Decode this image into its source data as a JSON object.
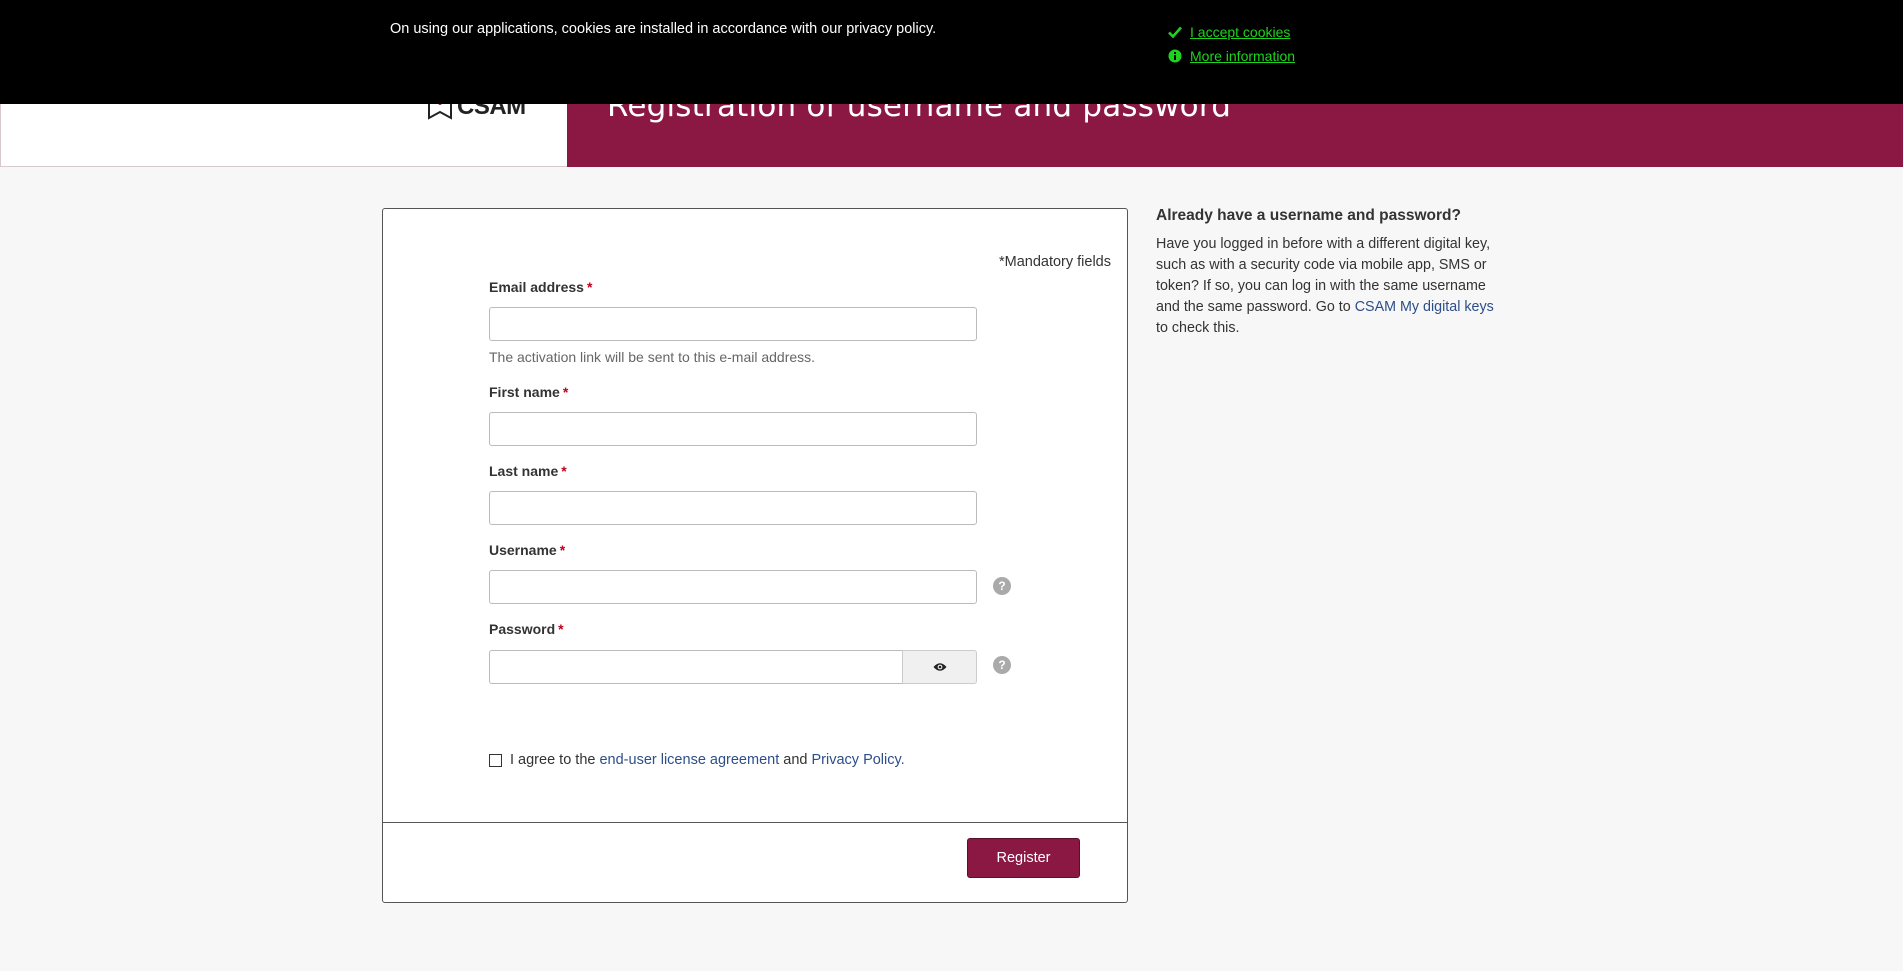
{
  "cookie_banner": {
    "message": "On using our applications, cookies are installed in accordance with our privacy policy.",
    "accept_label": "I accept cookies",
    "more_info_label": "More information",
    "accent_color": "#1ed31e"
  },
  "header": {
    "logo_text": "CSAM",
    "title": "Registration of username and password",
    "brand_color": "#8a1842"
  },
  "form": {
    "mandatory_note": "*Mandatory fields",
    "required_marker": "*",
    "email": {
      "label": "Email address",
      "value": "",
      "help": "The activation link will be sent to this e-mail address."
    },
    "first_name": {
      "label": "First name",
      "value": ""
    },
    "last_name": {
      "label": "Last name",
      "value": ""
    },
    "username": {
      "label": "Username",
      "value": ""
    },
    "password": {
      "label": "Password",
      "value": ""
    },
    "help_glyph": "?",
    "agreement": {
      "prefix": "I agree to the",
      "eula_link": "end-user license agreement",
      "middle": "and",
      "privacy_link": "Privacy Policy",
      "suffix": ".",
      "checked": false
    },
    "register_label": "Register"
  },
  "sidebar": {
    "title": "Already have a username and password?",
    "body_before_link": "Have you logged in before with a different digital key, such as with a security code via mobile app, SMS or token? If so, you can log in with the same username and the same password. Go to",
    "link_text": "CSAM My digital keys",
    "body_after_link": "to check this."
  }
}
